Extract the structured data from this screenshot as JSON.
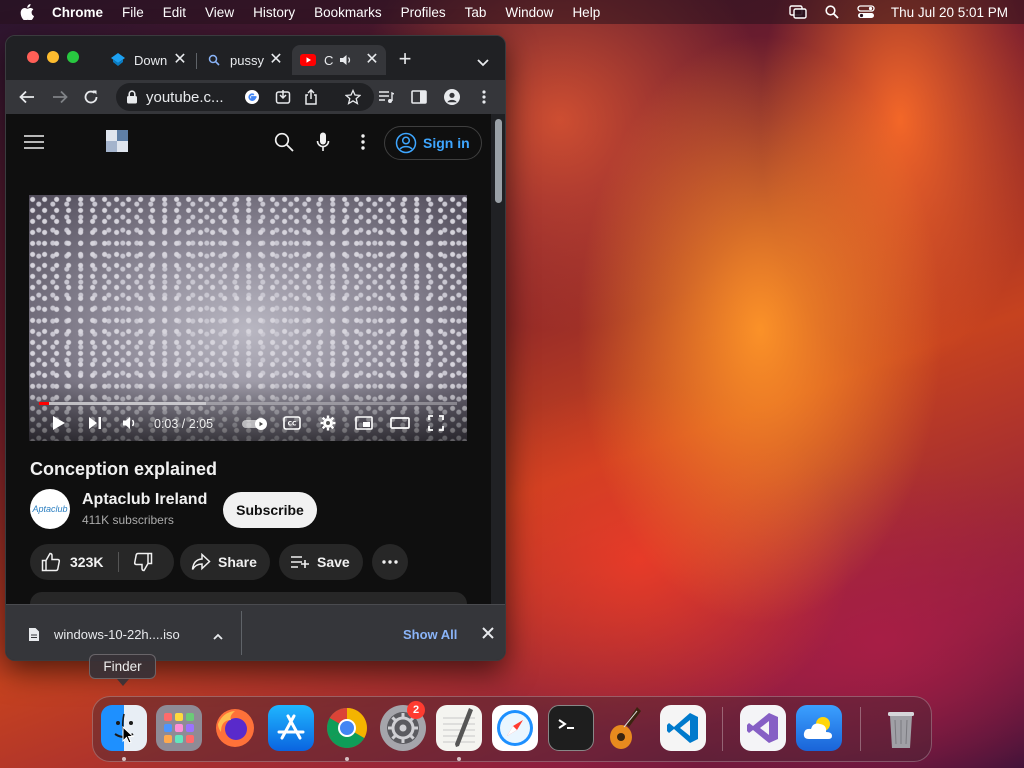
{
  "menubar": {
    "app_name": "Chrome",
    "items": [
      "File",
      "Edit",
      "View",
      "History",
      "Bookmarks",
      "Profiles",
      "Tab",
      "Window",
      "Help"
    ],
    "clock": "Thu Jul 20  5:01 PM"
  },
  "browser": {
    "tabs": [
      {
        "title": "Down",
        "icon": "download-site-icon"
      },
      {
        "title": "pussy",
        "icon": "search-icon"
      },
      {
        "title": "C",
        "icon": "youtube-icon",
        "audio": true
      }
    ],
    "url": "youtube.c..."
  },
  "youtube": {
    "sign_in_label": "Sign in",
    "player": {
      "time": "0:03 / 2:05",
      "played_fraction": 0.024,
      "buffered_fraction": 0.4
    },
    "video_title": "Conception explained",
    "channel": {
      "name": "Aptaclub Ireland",
      "subscribers": "411K subscribers",
      "avatar_text": "Aptaclub"
    },
    "subscribe_label": "Subscribe",
    "actions": {
      "likes": "323K",
      "share_label": "Share",
      "save_label": "Save"
    }
  },
  "download_shelf": {
    "filename": "windows-10-22h....iso",
    "show_all_label": "Show All"
  },
  "tooltip": {
    "text": "Finder"
  },
  "dock": {
    "apps": [
      "Finder",
      "Launchpad",
      "Firefox",
      "App Store",
      "Chrome",
      "System Settings",
      "TextEdit",
      "Safari",
      "Terminal",
      "GarageBand",
      "Visual Studio Code",
      "Visual Studio",
      "Weather",
      "Trash"
    ],
    "settings_badge": "2"
  }
}
